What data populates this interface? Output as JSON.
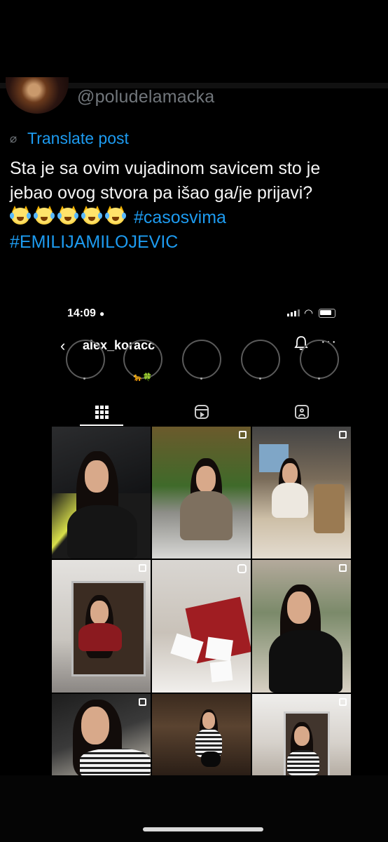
{
  "post": {
    "handle": "@poludelamacka",
    "translate_label": "Translate post",
    "text_line1": "Sta je sa ovim vujadinom savicem sto je",
    "text_line2": "jebao ovog stvora pa išao ga/je prijavi?",
    "hashtag1": "#casosvima",
    "hashtag2": "#EMILIJAMILOJEVIC",
    "emoji_name": "crying-cat-face-icon",
    "emoji_count": 5
  },
  "screenshot": {
    "time": "14:09",
    "username": "alex_koracc",
    "highlight_emojis": "🐆🍀",
    "tabs": [
      {
        "name": "grid-icon",
        "active": true
      },
      {
        "name": "reels-icon",
        "active": false
      },
      {
        "name": "tagged-icon",
        "active": false
      }
    ],
    "photos": [
      {
        "name": "car-selfie",
        "badge": "none"
      },
      {
        "name": "garden-restaurant",
        "badge": "multi"
      },
      {
        "name": "cafe-table",
        "badge": "multi"
      },
      {
        "name": "mirror-selfie-red-top",
        "badge": "multi"
      },
      {
        "name": "gift-boxes",
        "badge": "reel"
      },
      {
        "name": "black-top-selfie",
        "badge": "multi"
      },
      {
        "name": "close-up-car",
        "badge": "multi"
      },
      {
        "name": "bar-shelves",
        "badge": "none"
      },
      {
        "name": "mirror-selfie-striped",
        "badge": "multi"
      }
    ]
  },
  "colors": {
    "accent": "#1d9bf0",
    "muted": "#71767b",
    "background": "#000000"
  }
}
